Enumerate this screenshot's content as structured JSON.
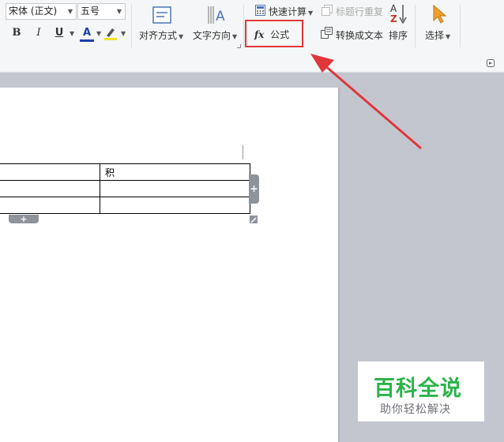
{
  "ribbon": {
    "font_name": "宋体 (正文)",
    "font_size": "五号",
    "bold": "B",
    "italic": "I",
    "underline": "U",
    "font_color_letter": "A",
    "align_label": "对齐方式",
    "text_direction_label": "文字方向",
    "quick_calc_label": "快速计算",
    "repeat_header_label": "标题行重复",
    "formula_fx": "fx",
    "formula_label": "公式",
    "convert_text_label": "转换成文本",
    "sort_label": "排序",
    "select_label": "选择",
    "sort_az_top": "A",
    "sort_az_bottom": "Z"
  },
  "table": {
    "rows": [
      [
        "",
        "积"
      ],
      [
        "",
        ""
      ],
      [
        "",
        ""
      ]
    ]
  },
  "watermark": {
    "title": "百科全说",
    "subtitle": "助你轻松解决"
  },
  "colors": {
    "highlight_box": "#e0373b",
    "arrow": "#e0373b",
    "watermark_green": "#2bb34a"
  }
}
